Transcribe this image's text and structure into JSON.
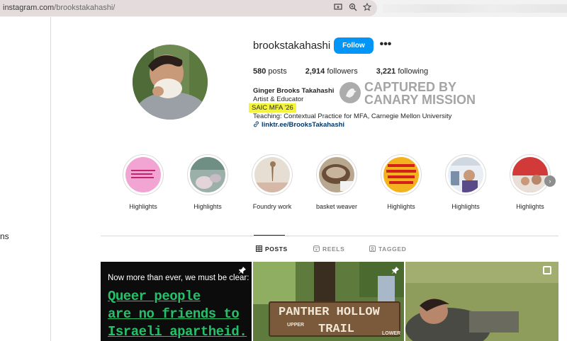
{
  "browser": {
    "url_host": "instagram.com",
    "url_path": "/brookstakahashi/"
  },
  "nav": {
    "fragment": "ns"
  },
  "profile": {
    "username": "brookstakahashi",
    "follow_label": "Follow",
    "more_label": "•••",
    "posts_count": "580",
    "posts_label": "posts",
    "followers_count": "2,914",
    "followers_label": "followers",
    "following_count": "3,221",
    "following_label": "following",
    "full_name": "Ginger Brooks Takahashi",
    "bio_line1": "Artist & Educator",
    "bio_line2": "SAIC MFA '26",
    "bio_line3": "Teaching: Contextual Practice for MFA, Carnegie Mellon University",
    "link_text": "linktr.ee/BrooksTakahashi",
    "link_icon": "link-icon"
  },
  "watermark": {
    "line1": "CAPTURED BY",
    "line2": "CANARY MISSION"
  },
  "highlights": [
    {
      "label": "Highlights"
    },
    {
      "label": "Highlights"
    },
    {
      "label": "Foundry work"
    },
    {
      "label": "basket weaver"
    },
    {
      "label": "Highlights"
    },
    {
      "label": "Highlights"
    },
    {
      "label": "Highlights"
    }
  ],
  "tabs": [
    {
      "label": "POSTS",
      "icon": "grid-icon",
      "active": true
    },
    {
      "label": "REELS",
      "icon": "reels-icon",
      "active": false
    },
    {
      "label": "TAGGED",
      "icon": "tagged-icon",
      "active": false
    }
  ],
  "posts": {
    "p1_line": "Now more than ever, we must be clear:",
    "p1_big1": "Queer people",
    "p1_big2": "are no friends to",
    "p1_big3": "Israeli apartheid.",
    "p2_sign1": "PANTHER HOLLOW",
    "p2_sign2": "TRAIL",
    "p2_small1": "UPPER",
    "p2_small2": "LOWER"
  },
  "colors": {
    "follow_button": "#0095f6",
    "highlight_marker": "#f4f53a",
    "link": "#00376b",
    "post_text_green": "#27c06a"
  }
}
